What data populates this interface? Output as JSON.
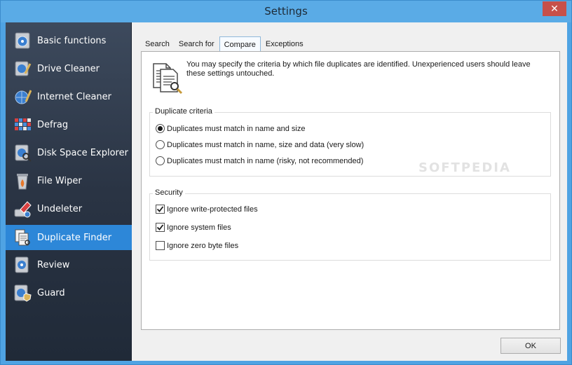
{
  "window": {
    "title": "Settings",
    "close_glyph": "✕"
  },
  "sidebar": {
    "items": [
      {
        "label": "Basic functions",
        "icon": "basic-functions-icon"
      },
      {
        "label": "Drive Cleaner",
        "icon": "drive-cleaner-icon"
      },
      {
        "label": "Internet Cleaner",
        "icon": "internet-cleaner-icon"
      },
      {
        "label": "Defrag",
        "icon": "defrag-icon"
      },
      {
        "label": "Disk Space Explorer",
        "icon": "disk-space-explorer-icon"
      },
      {
        "label": "File Wiper",
        "icon": "file-wiper-icon"
      },
      {
        "label": "Undeleter",
        "icon": "undeleter-icon"
      },
      {
        "label": "Duplicate Finder",
        "icon": "duplicate-finder-icon",
        "active": true
      },
      {
        "label": "Review",
        "icon": "review-icon"
      },
      {
        "label": "Guard",
        "icon": "guard-icon"
      }
    ]
  },
  "tabs": [
    {
      "label": "Search"
    },
    {
      "label": "Search for"
    },
    {
      "label": "Compare",
      "active": true
    },
    {
      "label": "Exceptions"
    }
  ],
  "panel": {
    "info_text": "You may specify the criteria by which file duplicates are identified. Unexperienced users should leave these settings untouched.",
    "duplicate_criteria": {
      "title": "Duplicate criteria",
      "options": [
        {
          "label": "Duplicates must match in name and size",
          "selected": true
        },
        {
          "label": "Duplicates must match in name, size and data (very slow)",
          "selected": false
        },
        {
          "label": "Duplicates must match in name (risky, not recommended)",
          "selected": false
        }
      ]
    },
    "security": {
      "title": "Security",
      "options": [
        {
          "label": "Ignore write-protected files",
          "checked": true
        },
        {
          "label": "Ignore system files",
          "checked": true
        },
        {
          "label": "Ignore zero byte files",
          "checked": false
        }
      ]
    },
    "watermark": "SOFTPEDIA"
  },
  "footer": {
    "ok_label": "OK"
  },
  "colors": {
    "accent": "#2d87d8",
    "titlebar": "#5aabe6",
    "close": "#c7504a"
  }
}
